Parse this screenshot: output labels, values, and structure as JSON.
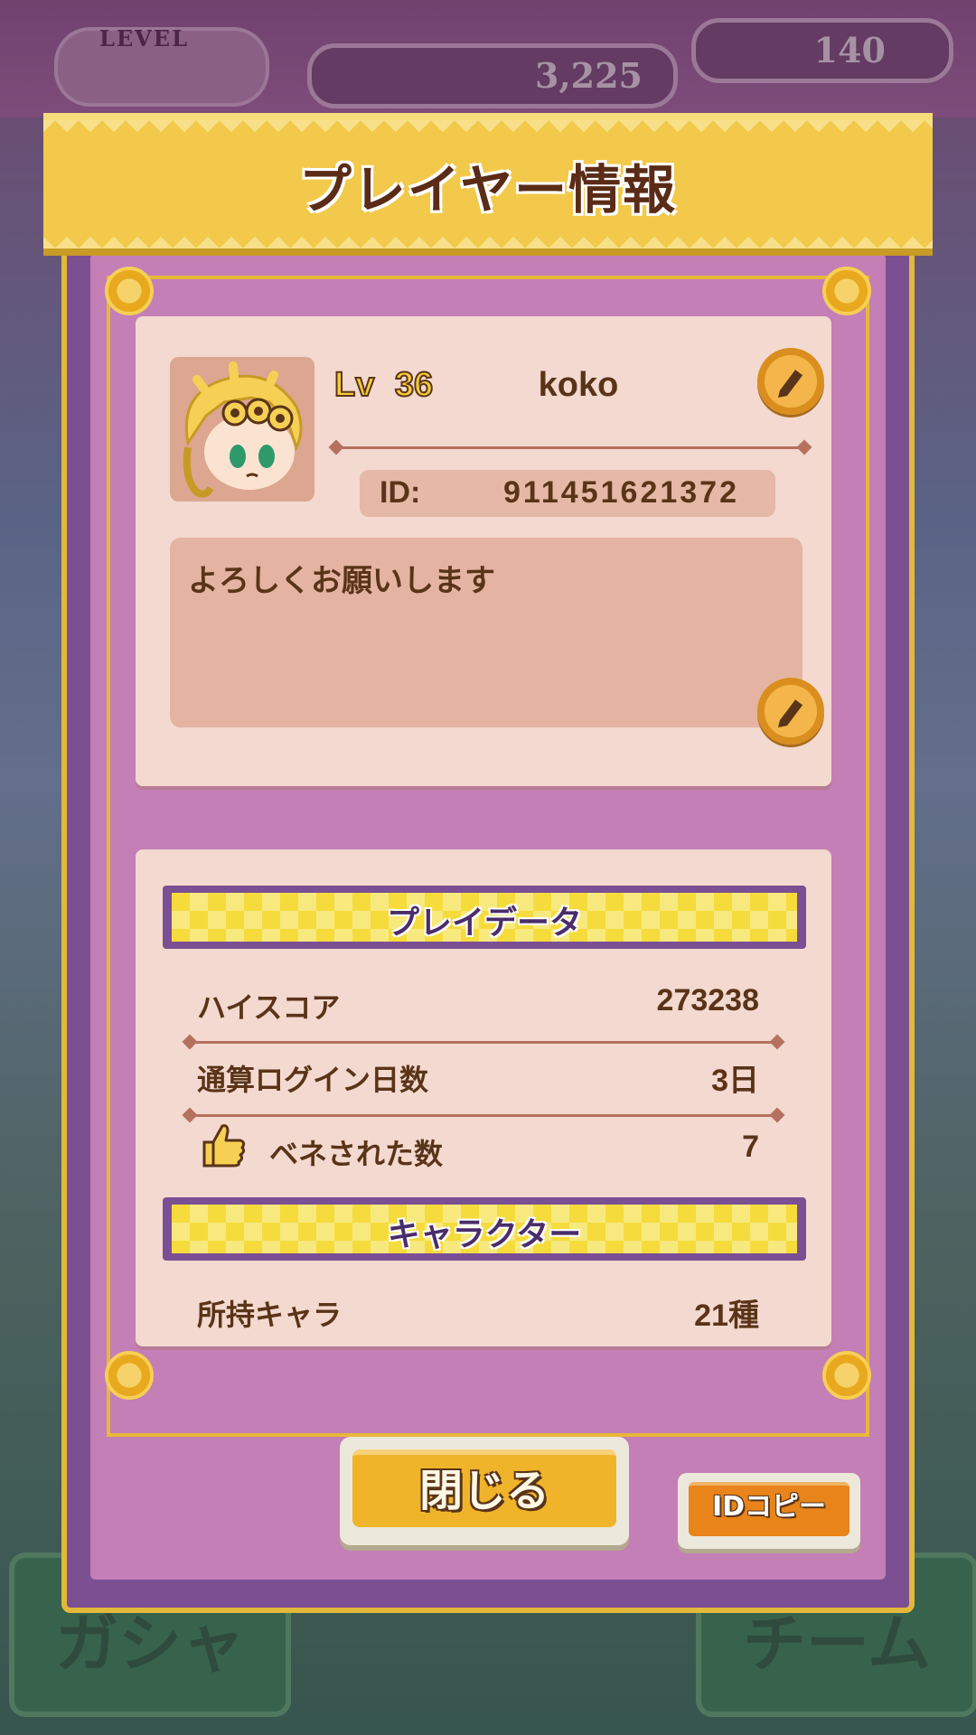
{
  "background": {
    "level_label": "LEVEL",
    "coins": "3,225",
    "gems": "140",
    "gacha_label": "ガシャ",
    "team_label": "チーム"
  },
  "dialog": {
    "title": "プレイヤー情報"
  },
  "profile": {
    "lv_prefix": "Lv",
    "level": "36",
    "name": "koko",
    "id_label": "ID:",
    "id_value": "911451621372",
    "comment": "よろしくお願いします"
  },
  "play_data": {
    "section_title": "プレイデータ",
    "rows": [
      {
        "label": "ハイスコア",
        "value": "273238"
      },
      {
        "label": "通算ログイン日数",
        "value": "3日"
      },
      {
        "label": "ベネされた数",
        "value": "7"
      }
    ]
  },
  "character": {
    "section_title": "キャラクター",
    "rows": [
      {
        "label": "所持キャラ",
        "value": "21種"
      }
    ]
  },
  "buttons": {
    "close_label": "閉じる",
    "copy_id_label": "IDコピー"
  },
  "colors": {
    "frame_purple": "#7c4f93",
    "panel_pink": "#c47fb6",
    "card_cream": "#f3d9cf",
    "gold": "#f2c94a",
    "text_brown": "#5a3418"
  }
}
